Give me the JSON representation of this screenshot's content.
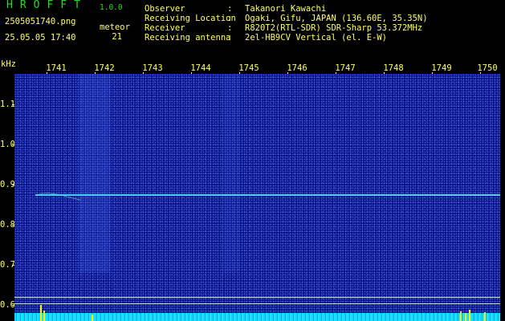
{
  "app": {
    "title": "HROFFT",
    "version": "1.0.0"
  },
  "capture": {
    "filename": "2505051740.png",
    "timestamp": "25.05.05 17:40",
    "meteor_label": "meteor",
    "meteor_count": "21"
  },
  "meta": [
    {
      "key": "Observer",
      "colon": ":",
      "value": "Takanori Kawachi"
    },
    {
      "key": "Receiving Location",
      "colon": ":",
      "value": "Ogaki, Gifu, JAPAN (136.60E, 35.35N)"
    },
    {
      "key": "Receiver",
      "colon": ":",
      "value": "R820T2(RTL-SDR) SDR-Sharp 53.372MHz"
    },
    {
      "key": "Receiving antenna",
      "colon": ":",
      "value": "2el-HB9CV Vertical (el. E-W)"
    }
  ],
  "xaxis": {
    "labels": [
      "1741",
      "1742",
      "1743",
      "1744",
      "1745",
      "1746",
      "1747",
      "1748",
      "1749",
      "1750"
    ]
  },
  "yaxis": {
    "unit": "kHz",
    "labels": [
      "1.1",
      "1.0",
      "0.9",
      "0.8",
      "0.7",
      "0.6"
    ]
  },
  "colors": {
    "label": "#ffff66",
    "title": "#22dd22",
    "background": "#08128a",
    "trail": "#50dcff",
    "spectrum": "#12d8ff",
    "spike": "#ffee00"
  }
}
